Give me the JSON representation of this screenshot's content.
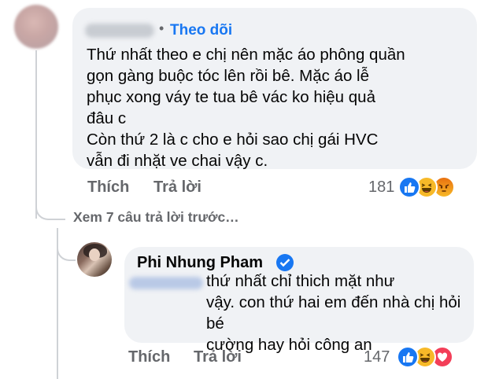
{
  "comment1": {
    "follow_label": "Theo dõi",
    "text": "Thứ nhất theo e chị nên mặc áo phông quần\ngọn gàng buộc tóc lên rồi bê. Mặc áo lễ\nphục xong váy te tua bê vác ko hiệu quả\nđâu c\nCòn thứ 2 là c cho e hỏi sao chị gái HVC\nvẫn đi nhặt ve chai vậy c.",
    "like_label": "Thích",
    "reply_label": "Trả lời",
    "reaction_count": "181",
    "reactions": [
      "like",
      "haha",
      "angry"
    ]
  },
  "view_previous_replies": "Xem 7 câu trả lời trước…",
  "reply": {
    "author": "Phi Nhung Pham",
    "text": "thứ nhất chỉ thich mặt như\nvậy. con thứ hai em đến nhà chị hỏi bé\ncường hay hỏi công an",
    "like_label": "Thích",
    "reply_label": "Trả lời",
    "reaction_count": "147",
    "reactions": [
      "like",
      "haha",
      "love"
    ]
  }
}
